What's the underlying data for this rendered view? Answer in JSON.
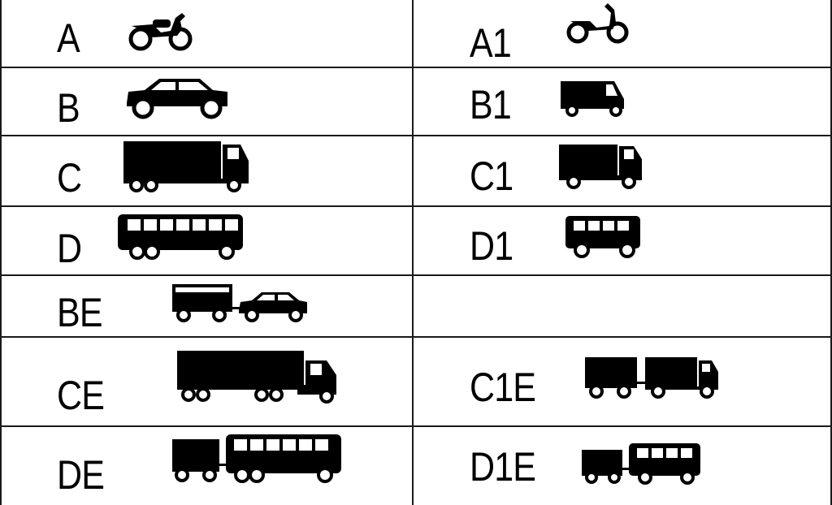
{
  "rows": [
    {
      "left": "A",
      "right": "A1"
    },
    {
      "left": "B",
      "right": "B1"
    },
    {
      "left": "C",
      "right": "C1"
    },
    {
      "left": "D",
      "right": "D1"
    },
    {
      "left": "BE",
      "right": ""
    },
    {
      "left": "CE",
      "right": "C1E"
    },
    {
      "left": "DE",
      "right": "D1E"
    }
  ],
  "icons": {
    "A": "motorcycle-icon",
    "A1": "light-motorcycle-icon",
    "B": "car-icon",
    "B1": "three-wheeler-icon",
    "C": "truck-icon",
    "C1": "light-truck-icon",
    "D": "bus-icon",
    "D1": "minibus-icon",
    "BE": "car-with-trailer-icon",
    "CE": "truck-with-trailer-icon",
    "C1E": "light-truck-with-trailer-icon",
    "DE": "bus-with-trailer-icon",
    "D1E": "minibus-with-trailer-icon"
  }
}
